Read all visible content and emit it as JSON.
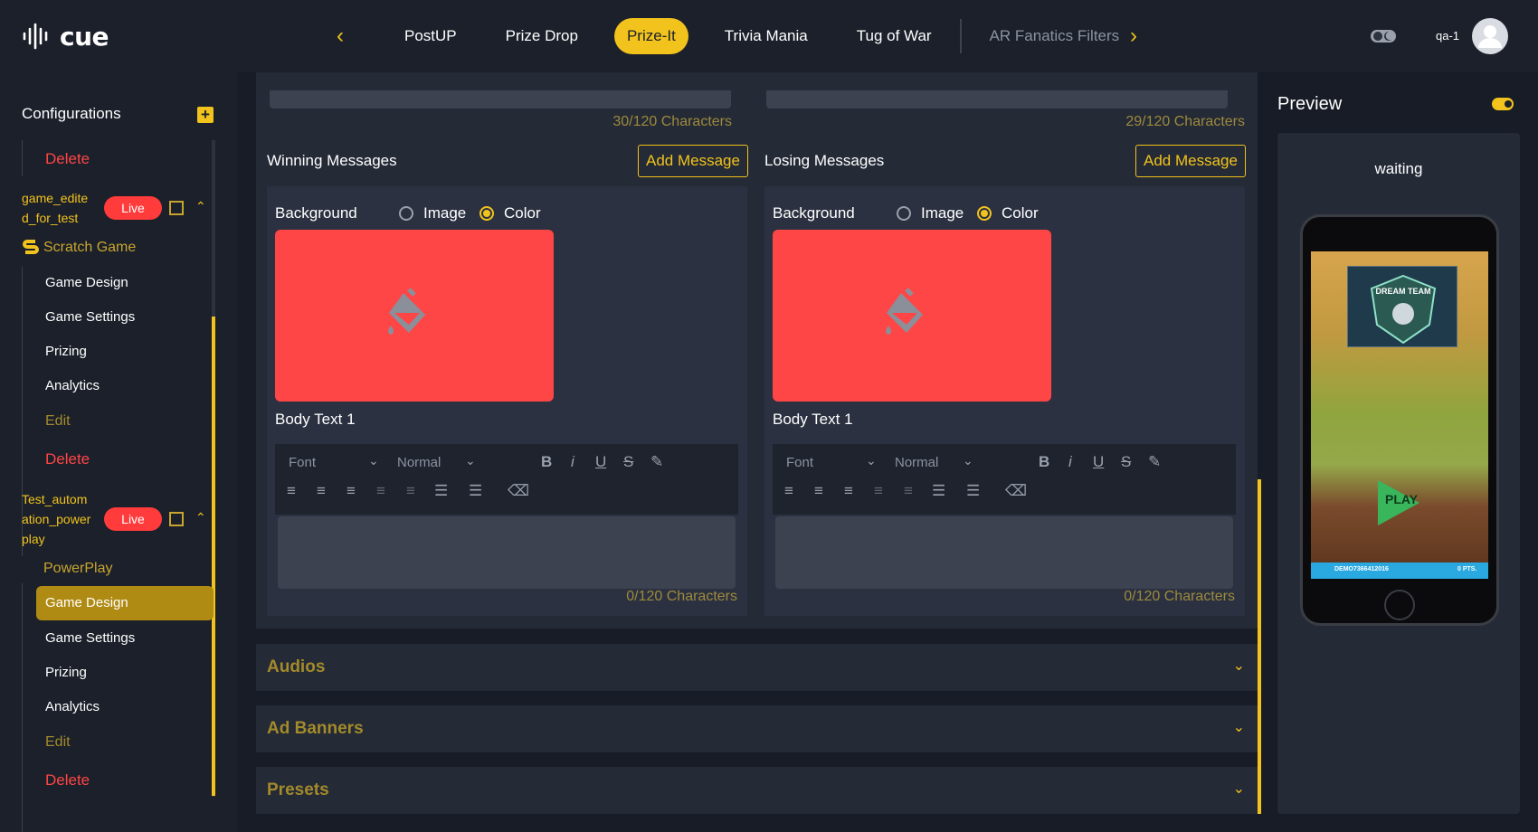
{
  "app": {
    "logo_text": "cue",
    "user": "qa-1"
  },
  "tabs": [
    {
      "label": "PostUP",
      "state": "normal"
    },
    {
      "label": "Prize Drop",
      "state": "normal"
    },
    {
      "label": "Prize-It",
      "state": "active"
    },
    {
      "label": "Trivia Mania",
      "state": "normal"
    },
    {
      "label": "Tug of War",
      "state": "normal"
    },
    {
      "label": "AR Fanatics Filters",
      "state": "dim"
    }
  ],
  "sidebar": {
    "title": "Configurations",
    "add_label": "+",
    "items_top": {
      "delete": "Delete"
    },
    "game1": {
      "name_line1": "game_edite",
      "name_line2": "d_for_test",
      "live": "Live",
      "type": "Scratch Game",
      "children": [
        "Game Design",
        "Game Settings",
        "Prizing",
        "Analytics"
      ],
      "edit": "Edit",
      "delete": "Delete"
    },
    "game2": {
      "name_line1": "Test_autom",
      "name_line2": "ation_power",
      "name_line3": "play",
      "live": "Live",
      "type": "PowerPlay",
      "children": [
        "Game Design",
        "Game Settings",
        "Prizing",
        "Analytics"
      ],
      "active_child": "Game Design",
      "edit": "Edit",
      "delete": "Delete"
    }
  },
  "editor": {
    "left_top_count": "30/120 Characters",
    "right_top_count": "29/120 Characters",
    "winning": {
      "title": "Winning Messages",
      "add_label": "Add Message",
      "background_label": "Background",
      "option_image": "Image",
      "option_color": "Color",
      "selected": "Color",
      "swatch_color": "#ff4646",
      "body_label": "Body Text 1",
      "font_placeholder": "Font",
      "size_placeholder": "Normal",
      "count": "0/120 Characters"
    },
    "losing": {
      "title": "Losing Messages",
      "add_label": "Add Message",
      "background_label": "Background",
      "option_image": "Image",
      "option_color": "Color",
      "selected": "Color",
      "swatch_color": "#ff4646",
      "body_label": "Body Text 1",
      "font_placeholder": "Font",
      "size_placeholder": "Normal",
      "count": "0/120 Characters"
    }
  },
  "sections": [
    {
      "title": "Audios"
    },
    {
      "title": "Ad Banners"
    },
    {
      "title": "Presets"
    }
  ],
  "preview": {
    "title": "Preview",
    "status": "waiting",
    "team_text": "DREAM TEAM",
    "play_text": "PLAY",
    "bar_left": "DEMO7366412016",
    "bar_right": "0 PTS."
  },
  "colors": {
    "accent": "#f2c31d",
    "danger": "#ff4545",
    "bg": "#171c26",
    "panel": "#242a36"
  }
}
